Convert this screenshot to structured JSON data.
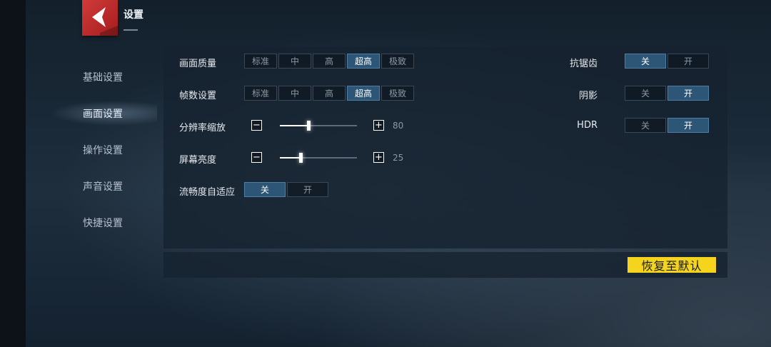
{
  "header": {
    "title": "设置",
    "logo_icon": "back-arrow-icon"
  },
  "sidebar": {
    "items": [
      {
        "label": "基础设置",
        "active": false
      },
      {
        "label": "画面设置",
        "active": true
      },
      {
        "label": "操作设置",
        "active": false
      },
      {
        "label": "声音设置",
        "active": false
      },
      {
        "label": "快捷设置",
        "active": false
      }
    ]
  },
  "graphics": {
    "quality": {
      "label": "画面质量",
      "options": [
        "标准",
        "中",
        "高",
        "超高",
        "极致"
      ],
      "selected": "超高"
    },
    "fps": {
      "label": "帧数设置",
      "options": [
        "标准",
        "中",
        "高",
        "超高",
        "极致"
      ],
      "selected": "超高"
    },
    "resolution": {
      "label": "分辨率缩放",
      "value": "80",
      "level": 0.37,
      "minus": "−",
      "plus": "+"
    },
    "brightness": {
      "label": "屏幕亮度",
      "value": "25",
      "level": 0.27,
      "minus": "−",
      "plus": "+"
    },
    "adaptive": {
      "label": "流畅度自适应",
      "options": [
        "关",
        "开"
      ],
      "selected": "关"
    },
    "antialias": {
      "label": "抗锯齿",
      "options": [
        "关",
        "开"
      ],
      "selected": "关"
    },
    "shadow": {
      "label": "阴影",
      "options": [
        "关",
        "开"
      ],
      "selected": "开"
    },
    "hdr": {
      "label": "HDR",
      "options": [
        "关",
        "开"
      ],
      "selected": "开"
    }
  },
  "footer": {
    "reset_label": "恢复至默认"
  },
  "colors": {
    "accent_yellow": "#f4d41c",
    "selected_blue": "#2d5676",
    "logo_red": "#c22b2b"
  }
}
